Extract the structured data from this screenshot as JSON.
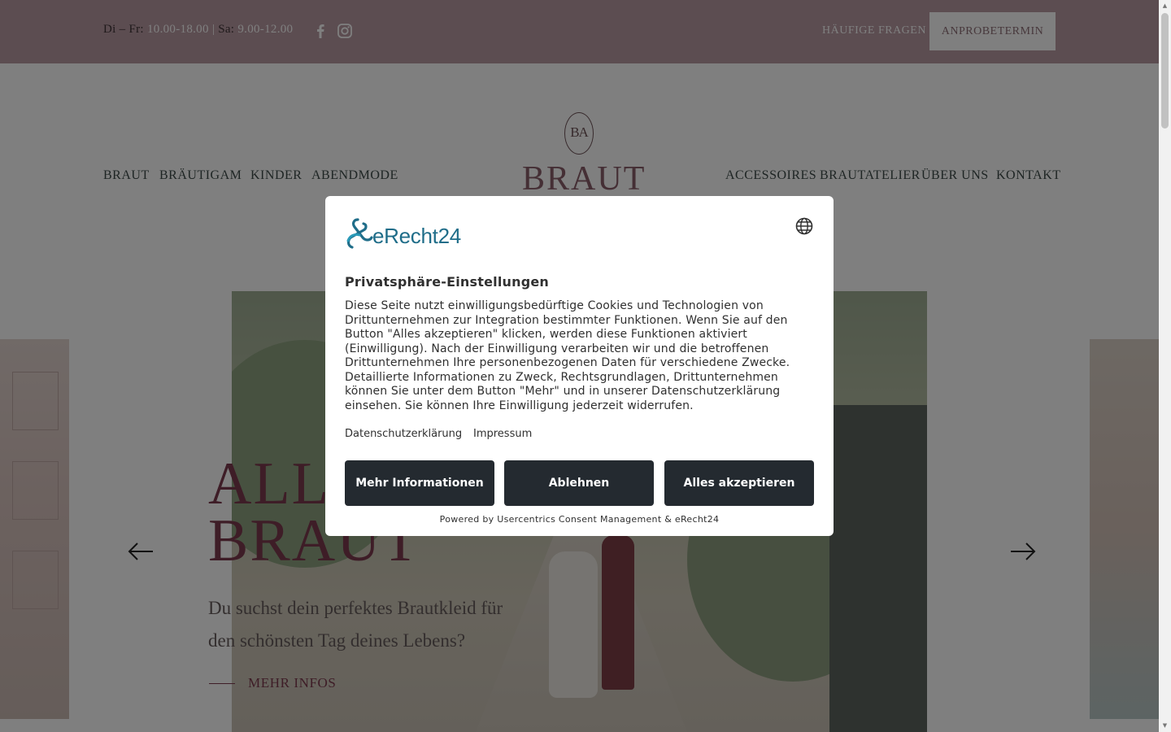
{
  "topbar": {
    "hours_label_1": "Di – Fr:",
    "hours_value_1": "10.00-18.00",
    "separator": "|",
    "hours_label_2": "Sa:",
    "hours_value_2": "9.00-12.00",
    "faq_label": "HÄUFIGE FRAGEN",
    "appointment_label": "ANPROBETERMIN"
  },
  "nav": {
    "left": [
      "BRAUT",
      "BRÄUTIGAM",
      "KINDER",
      "ABENDMODE"
    ],
    "right": [
      "ACCESSOIRES",
      "BRAUTATELIER",
      "ÜBER UNS",
      "KONTAKT"
    ]
  },
  "logo": {
    "monogram": "BA",
    "word": "BRAUT"
  },
  "hero": {
    "title_line_1": "ALLE",
    "title_line_2": "BRAUT",
    "text": "Du suchst dein perfektes Brautkleid für den schönsten Tag deines Lebens?",
    "more_label": "MEHR INFOS"
  },
  "consent": {
    "brand": "eRecht24",
    "title": "Privatsphäre-Einstellungen",
    "body": "Diese Seite nutzt einwilligungsbedürftige Cookies und Technologien von Drittunternehmen zur Integration bestimmter Funktionen. Wenn Sie auf den Button \"Alles akzeptieren\" klicken, werden diese Funktionen aktiviert (Einwilligung). Nach der Einwilligung verarbeiten wir und die betroffenen Drittunternehmen Ihre personenbezogenen Daten für verschiedene Zwecke. Detaillierte Informationen zu Zweck, Rechtsgrundlagen, Drittunternehmen können Sie unter dem Button \"Mehr\" und in unserer Datenschutzerklärung einsehen. Sie können Ihre Einwilligung jederzeit widerrufen.",
    "link_privacy": "Datenschutzerklärung",
    "link_imprint": "Impressum",
    "btn_more": "Mehr Informationen",
    "btn_decline": "Ablehnen",
    "btn_accept": "Alles akzeptieren",
    "footer": "Powered by Usercentrics Consent Management & eRecht24"
  },
  "colors": {
    "topbar": "#b89aa3",
    "accent": "#7d3a4e",
    "nav_text": "#3d4a48",
    "modal_button": "#242a30",
    "brand_blue": "#1f6d89"
  },
  "icons": [
    "facebook-icon",
    "instagram-icon",
    "arrow-left-icon",
    "arrow-right-icon",
    "globe-icon",
    "erecht24-logo-icon"
  ]
}
